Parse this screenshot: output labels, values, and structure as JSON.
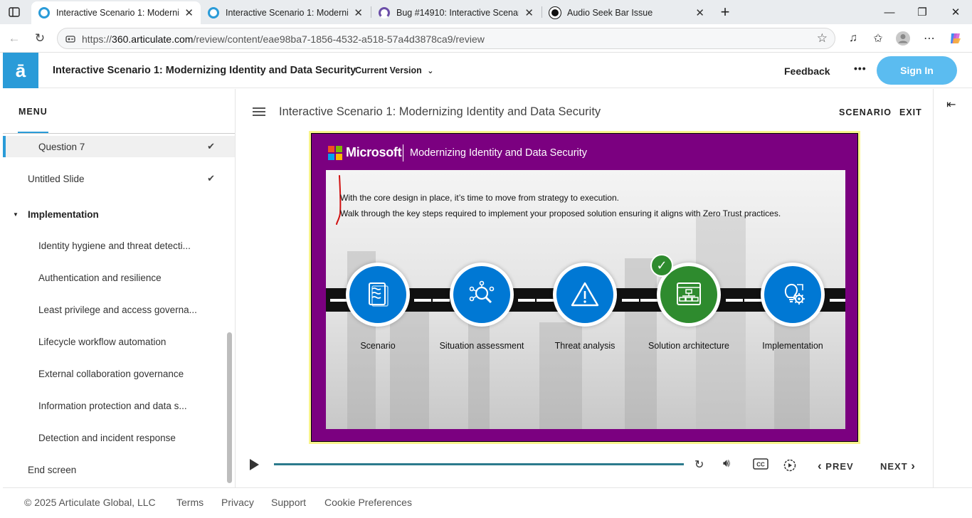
{
  "browser": {
    "tabs": [
      {
        "title": "Interactive Scenario 1: Modernizin",
        "active": true,
        "favicon_color": "#2a9bd8"
      },
      {
        "title": "Interactive Scenario 1: Modernizin",
        "active": false,
        "favicon_color": "#2a9bd8"
      },
      {
        "title": "Bug #14910: Interactive Scenario",
        "active": false,
        "favicon_color": "#6b4ea8"
      },
      {
        "title": "Audio Seek Bar Issue",
        "active": false,
        "favicon_color": "#111111"
      }
    ],
    "url_prefix": "https://",
    "url_host": "360.articulate.com",
    "url_path": "/review/content/eae98ba7-1856-4532-a518-57a4d3878ca9/review"
  },
  "header": {
    "logo_glyph": "ā",
    "course_title": "Interactive Scenario 1: Modernizing Identity and Data Security",
    "version_label": "Current Version",
    "feedback_label": "Feedback",
    "more_label": "•••",
    "signin_label": "Sign In"
  },
  "menu": {
    "heading": "MENU",
    "items": [
      {
        "label": "Question 7",
        "indent": 2,
        "checked": true,
        "current": true
      },
      {
        "label": "Untitled Slide",
        "indent": 1,
        "checked": true
      },
      {
        "label": "Implementation",
        "indent": 1,
        "section": true
      },
      {
        "label": "Identity hygiene and threat detecti...",
        "indent": 2
      },
      {
        "label": "Authentication and resilience",
        "indent": 2
      },
      {
        "label": "Least privilege and access governa...",
        "indent": 2
      },
      {
        "label": "Lifecycle workflow automation",
        "indent": 2
      },
      {
        "label": "External collaboration governance",
        "indent": 2
      },
      {
        "label": "Information protection and data s...",
        "indent": 2
      },
      {
        "label": "Detection and incident response",
        "indent": 2
      },
      {
        "label": "End screen",
        "indent": 1
      }
    ]
  },
  "lesson": {
    "title": "Interactive Scenario 1: Modernizing Identity and Data Security",
    "scenario_label": "SCENARIO",
    "exit_label": "EXIT"
  },
  "slide": {
    "brand": "Microsoft",
    "title": "Modernizing Identity and Data Security",
    "intro_line1": "With the core design in place, it’s time to move from strategy to execution.",
    "intro_line2": "Walk through the key steps required to implement your proposed solution ensuring it aligns with Zero Trust practices.",
    "steps": [
      {
        "label": "Scenario",
        "icon": "document-icon",
        "completed": false
      },
      {
        "label": "Situation assessment",
        "icon": "magnifier-network-icon",
        "completed": false
      },
      {
        "label": "Threat analysis",
        "icon": "warning-icon",
        "completed": false
      },
      {
        "label": "Solution architecture",
        "icon": "architecture-icon",
        "completed": true
      },
      {
        "label": "Implementation",
        "icon": "lightbulb-gear-icon",
        "completed": false
      }
    ],
    "colors": {
      "frame": "#7b0080",
      "step_blue": "#0078d4",
      "step_green": "#2e8b2e"
    }
  },
  "player": {
    "prev_label": "PREV",
    "next_label": "NEXT"
  },
  "footer": {
    "copyright": "© 2025 Articulate Global, LLC",
    "links": [
      "Terms",
      "Privacy",
      "Support",
      "Cookie Preferences"
    ]
  }
}
